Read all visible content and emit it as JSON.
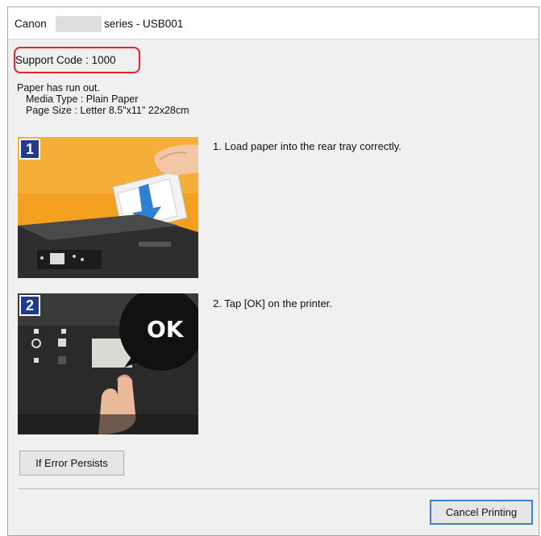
{
  "window": {
    "title_prefix": "Canon",
    "title_suffix": "series - USB001"
  },
  "support_code": "Support Code : 1000",
  "message": {
    "line1": "Paper has run out.",
    "media_type": "Media Type : Plain Paper",
    "page_size": "Page Size : Letter 8.5\"x11\" 22x28cm"
  },
  "steps": [
    {
      "number": "1",
      "text": "1.  Load paper into the rear tray correctly."
    },
    {
      "number": "2",
      "text": "2.  Tap [OK] on the printer.",
      "callout": "OK"
    }
  ],
  "buttons": {
    "if_error_persists": "If Error Persists",
    "cancel_printing": "Cancel Printing"
  },
  "colors": {
    "highlight_border": "#e5222b",
    "step_badge": "#1f3b8f",
    "step1_background": "#f3a020"
  }
}
